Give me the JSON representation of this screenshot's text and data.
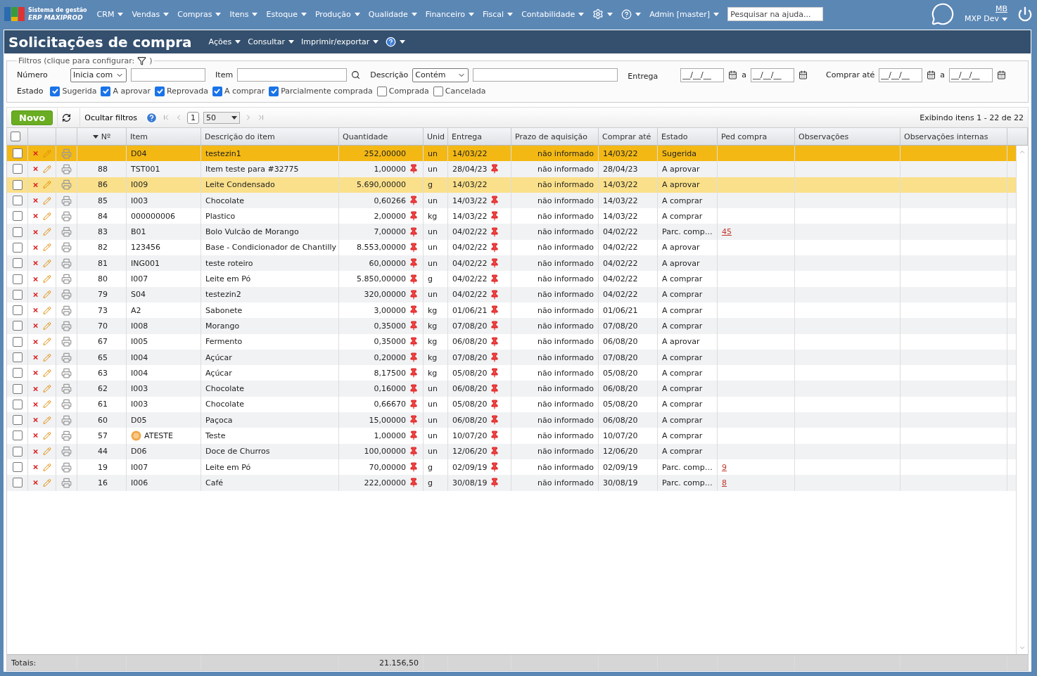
{
  "app": {
    "subtitle": "Sistema de gestão",
    "name": "ERP MAXIPROD"
  },
  "menu": [
    "CRM",
    "Vendas",
    "Compras",
    "Itens",
    "Estoque",
    "Produção",
    "Qualidade",
    "Financeiro",
    "Fiscal",
    "Contabilidade"
  ],
  "user": "Admin [master]",
  "help_search": {
    "placeholder": "Pesquisar na ajuda..."
  },
  "account": {
    "initials": "MB",
    "company": "MXP Dev"
  },
  "page_title": "Solicitações de compra",
  "page_menu": [
    "Ações",
    "Consultar",
    "Imprimir/exportar"
  ],
  "filters": {
    "legend": "Filtros (clique para configurar:",
    "legend_end": ")",
    "numero_label": "Número",
    "numero_mode": "Inicia com",
    "item_label": "Item",
    "descricao_label": "Descrição",
    "descricao_mode": "Contém",
    "entrega_label": "Entrega",
    "entrega_from": "__/__/__",
    "entrega_sep": "a",
    "entrega_to": "__/__/__",
    "comprar_label": "Comprar até",
    "comprar_from": "__/__/__",
    "comprar_sep": "a",
    "comprar_to": "__/__/__",
    "estado_label": "Estado",
    "states": [
      {
        "label": "Sugerida",
        "checked": true
      },
      {
        "label": "A aprovar",
        "checked": true
      },
      {
        "label": "Reprovada",
        "checked": true
      },
      {
        "label": "A comprar",
        "checked": true
      },
      {
        "label": "Parcialmente comprada",
        "checked": true
      },
      {
        "label": "Comprada",
        "checked": false
      },
      {
        "label": "Cancelada",
        "checked": false
      }
    ]
  },
  "toolbar": {
    "new": "Novo",
    "hide_filters": "Ocultar filtros",
    "page": "1",
    "per_page": "50",
    "showing": "Exibindo itens 1 - 22 de 22"
  },
  "table": {
    "all_checked": false,
    "columns": [
      "Nº",
      "Item",
      "Descrição do item",
      "Quantidade",
      "Unid",
      "Entrega",
      "Prazo de aquisição",
      "Comprar até",
      "Estado",
      "Ped compra",
      "Observações",
      "Observações internas"
    ],
    "rows": [
      {
        "num": "",
        "item": "D04",
        "desc": "testezin1",
        "qty": "252,00000",
        "unit": "un",
        "delivery": "14/03/22",
        "lead": "não informado",
        "buy_by": "14/03/22",
        "state": "Sugerida",
        "order": "",
        "checked": false,
        "selected": true,
        "hovered": false,
        "pinned": false
      },
      {
        "num": "88",
        "item": "TST001",
        "desc": "Item teste para #32775",
        "qty": "1,00000",
        "unit": "un",
        "delivery": "28/04/23",
        "lead": "não informado",
        "buy_by": "28/04/23",
        "state": "A aprovar",
        "order": "",
        "checked": false,
        "selected": false,
        "hovered": false,
        "pinned": true
      },
      {
        "num": "86",
        "item": "I009",
        "desc": "Leite Condensado",
        "qty": "5.690,00000",
        "unit": "g",
        "delivery": "14/03/22",
        "lead": "não informado",
        "buy_by": "14/03/22",
        "state": "A aprovar",
        "order": "",
        "checked": false,
        "selected": false,
        "hovered": true,
        "pinned": false
      },
      {
        "num": "85",
        "item": "I003",
        "desc": "Chocolate",
        "qty": "0,60266",
        "unit": "un",
        "delivery": "14/03/22",
        "lead": "não informado",
        "buy_by": "14/03/22",
        "state": "A comprar",
        "order": "",
        "checked": false,
        "selected": false,
        "hovered": false,
        "pinned": true
      },
      {
        "num": "84",
        "item": "000000006",
        "desc": "Plastico",
        "qty": "2,00000",
        "unit": "kg",
        "delivery": "14/03/22",
        "lead": "não informado",
        "buy_by": "14/03/22",
        "state": "A comprar",
        "order": "",
        "checked": false,
        "selected": false,
        "hovered": false,
        "pinned": true
      },
      {
        "num": "83",
        "item": "B01",
        "desc": "Bolo Vulcão de Morango",
        "qty": "7,00000",
        "unit": "un",
        "delivery": "04/02/22",
        "lead": "não informado",
        "buy_by": "04/02/22",
        "state": "Parc. comp…",
        "order": "45",
        "checked": false,
        "selected": false,
        "hovered": false,
        "pinned": true
      },
      {
        "num": "82",
        "item": "123456",
        "desc": "Base - Condicionador de Chantilly",
        "qty": "8.553,00000",
        "unit": "un",
        "delivery": "04/02/22",
        "lead": "não informado",
        "buy_by": "04/02/22",
        "state": "A aprovar",
        "order": "",
        "checked": false,
        "selected": false,
        "hovered": false,
        "pinned": true
      },
      {
        "num": "81",
        "item": "ING001",
        "desc": "teste roteiro",
        "qty": "60,00000",
        "unit": "un",
        "delivery": "04/02/22",
        "lead": "não informado",
        "buy_by": "04/02/22",
        "state": "A aprovar",
        "order": "",
        "checked": false,
        "selected": false,
        "hovered": false,
        "pinned": true
      },
      {
        "num": "80",
        "item": "I007",
        "desc": "Leite em Pó",
        "qty": "5.850,00000",
        "unit": "g",
        "delivery": "04/02/22",
        "lead": "não informado",
        "buy_by": "04/02/22",
        "state": "A comprar",
        "order": "",
        "checked": false,
        "selected": false,
        "hovered": false,
        "pinned": true
      },
      {
        "num": "79",
        "item": "S04",
        "desc": "testezin2",
        "qty": "320,00000",
        "unit": "un",
        "delivery": "04/02/22",
        "lead": "não informado",
        "buy_by": "04/02/22",
        "state": "A comprar",
        "order": "",
        "checked": false,
        "selected": false,
        "hovered": false,
        "pinned": true
      },
      {
        "num": "73",
        "item": "A2",
        "desc": "Sabonete",
        "qty": "3,00000",
        "unit": "kg",
        "delivery": "01/06/21",
        "lead": "não informado",
        "buy_by": "01/06/21",
        "state": "A comprar",
        "order": "",
        "checked": false,
        "selected": false,
        "hovered": false,
        "pinned": true
      },
      {
        "num": "70",
        "item": "I008",
        "desc": "Morango",
        "qty": "0,35000",
        "unit": "kg",
        "delivery": "07/08/20",
        "lead": "não informado",
        "buy_by": "07/08/20",
        "state": "A comprar",
        "order": "",
        "checked": false,
        "selected": false,
        "hovered": false,
        "pinned": true
      },
      {
        "num": "67",
        "item": "I005",
        "desc": "Fermento",
        "qty": "0,35000",
        "unit": "kg",
        "delivery": "06/08/20",
        "lead": "não informado",
        "buy_by": "06/08/20",
        "state": "A aprovar",
        "order": "",
        "checked": false,
        "selected": false,
        "hovered": false,
        "pinned": true
      },
      {
        "num": "65",
        "item": "I004",
        "desc": "Açúcar",
        "qty": "0,20000",
        "unit": "kg",
        "delivery": "07/08/20",
        "lead": "não informado",
        "buy_by": "07/08/20",
        "state": "A comprar",
        "order": "",
        "checked": false,
        "selected": false,
        "hovered": false,
        "pinned": true
      },
      {
        "num": "63",
        "item": "I004",
        "desc": "Açúcar",
        "qty": "8,17500",
        "unit": "kg",
        "delivery": "05/08/20",
        "lead": "não informado",
        "buy_by": "05/08/20",
        "state": "A comprar",
        "order": "",
        "checked": false,
        "selected": false,
        "hovered": false,
        "pinned": true
      },
      {
        "num": "62",
        "item": "I003",
        "desc": "Chocolate",
        "qty": "0,16000",
        "unit": "un",
        "delivery": "06/08/20",
        "lead": "não informado",
        "buy_by": "06/08/20",
        "state": "A comprar",
        "order": "",
        "checked": false,
        "selected": false,
        "hovered": false,
        "pinned": true
      },
      {
        "num": "61",
        "item": "I003",
        "desc": "Chocolate",
        "qty": "0,66670",
        "unit": "un",
        "delivery": "05/08/20",
        "lead": "não informado",
        "buy_by": "05/08/20",
        "state": "A comprar",
        "order": "",
        "checked": false,
        "selected": false,
        "hovered": false,
        "pinned": true
      },
      {
        "num": "60",
        "item": "D05",
        "desc": "Paçoca",
        "qty": "15,00000",
        "unit": "un",
        "delivery": "06/08/20",
        "lead": "não informado",
        "buy_by": "06/08/20",
        "state": "A comprar",
        "order": "",
        "checked": false,
        "selected": false,
        "hovered": false,
        "pinned": true
      },
      {
        "num": "57",
        "item": "ATESTE",
        "item_icon": true,
        "desc": "Teste",
        "qty": "1,00000",
        "unit": "un",
        "delivery": "10/07/20",
        "lead": "não informado",
        "buy_by": "10/07/20",
        "state": "A comprar",
        "order": "",
        "checked": false,
        "selected": false,
        "hovered": false,
        "pinned": true
      },
      {
        "num": "44",
        "item": "D06",
        "desc": "Doce de Churros",
        "qty": "100,00000",
        "unit": "un",
        "delivery": "12/06/20",
        "lead": "não informado",
        "buy_by": "12/06/20",
        "state": "A comprar",
        "order": "",
        "checked": false,
        "selected": false,
        "hovered": false,
        "pinned": true
      },
      {
        "num": "19",
        "item": "I007",
        "desc": "Leite em Pó",
        "qty": "70,00000",
        "unit": "g",
        "delivery": "02/09/19",
        "lead": "não informado",
        "buy_by": "02/09/19",
        "state": "Parc. comp…",
        "order": "9",
        "checked": false,
        "selected": false,
        "hovered": false,
        "pinned": true
      },
      {
        "num": "16",
        "item": "I006",
        "desc": "Café",
        "qty": "222,00000",
        "unit": "g",
        "delivery": "30/08/19",
        "lead": "não informado",
        "buy_by": "30/08/19",
        "state": "Parc. comp…",
        "order": "8",
        "checked": false,
        "selected": false,
        "hovered": false,
        "pinned": true
      }
    ],
    "totals_label": "Totais:",
    "total_qty": "21.156,50"
  }
}
